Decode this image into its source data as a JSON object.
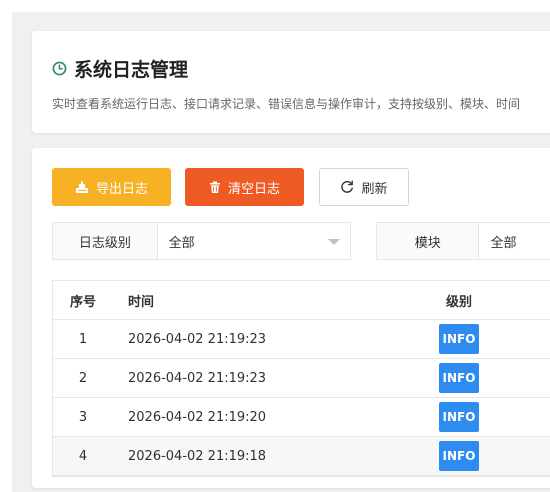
{
  "header": {
    "title": "系统日志管理",
    "description": "实时查看系统运行日志、接口请求记录、错误信息与操作审计，支持按级别、模块、时间"
  },
  "toolbar": {
    "export_label": "导出日志",
    "clear_label": "清空日志",
    "refresh_label": "刷新"
  },
  "filters": {
    "level": {
      "label": "日志级别",
      "value": "全部"
    },
    "module": {
      "label": "模块",
      "value": "全部"
    }
  },
  "table": {
    "columns": [
      "序号",
      "时间",
      "级别"
    ],
    "rows": [
      {
        "index": "1",
        "time": "2026-04-02 21:19:23",
        "level": "INFO"
      },
      {
        "index": "2",
        "time": "2026-04-02 21:19:23",
        "level": "INFO"
      },
      {
        "index": "3",
        "time": "2026-04-02 21:19:20",
        "level": "INFO"
      },
      {
        "index": "4",
        "time": "2026-04-02 21:19:18",
        "level": "INFO"
      }
    ]
  },
  "colors": {
    "export": "#f7b125",
    "clear": "#ee5b25",
    "info_badge": "#2e8cf0",
    "title_icon": "#2d8c72"
  },
  "icons": [
    "clock-icon",
    "export-icon",
    "trash-icon",
    "refresh-icon",
    "chevron-down-icon"
  ]
}
